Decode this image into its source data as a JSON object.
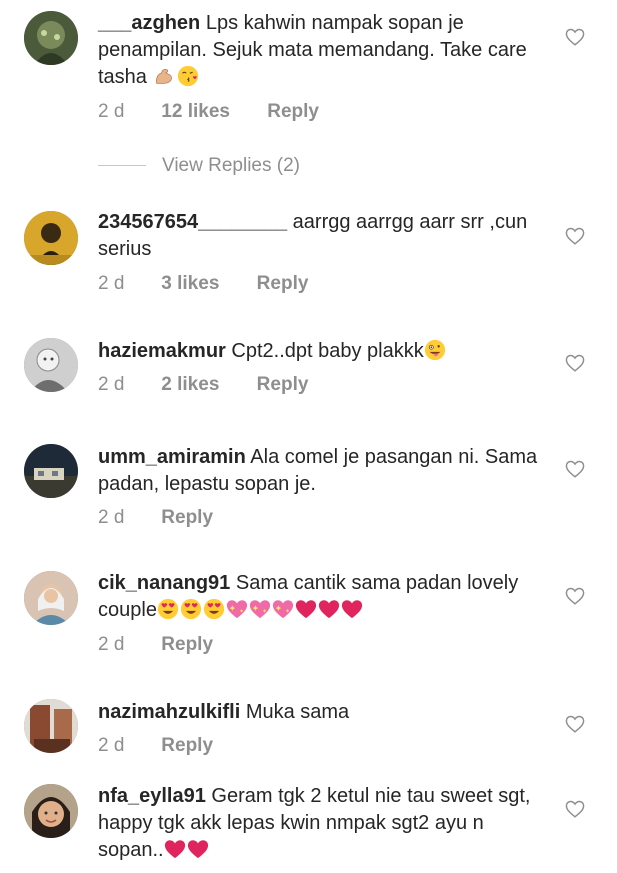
{
  "comments": [
    {
      "username": "___azghen",
      "text": "Lps kahwin nampak sopan je penampilan. Sejuk mata memandang. Take care tasha",
      "emojis": [
        "flexed-biceps-icon",
        "face-blowing-kiss-icon"
      ],
      "time": "2 d",
      "likes": "12 likes",
      "reply": "Reply",
      "avatar_color": "#5d6b4a"
    },
    {
      "username": "234567654________",
      "text": "aarrgg aarrgg aarr srr ,cun serius",
      "emojis": [],
      "time": "2 d",
      "likes": "3 likes",
      "reply": "Reply",
      "avatar_color": "#c9a227"
    },
    {
      "username": "haziemakmur",
      "text": "Cpt2..dpt baby plakkk",
      "emojis": [
        "zany-face-icon"
      ],
      "time": "2 d",
      "likes": "2 likes",
      "reply": "Reply",
      "avatar_color": "#9a9a9a"
    },
    {
      "username": "umm_amiramin",
      "text": "Ala comel je pasangan ni. Sama padan, lepastu sopan je.",
      "emojis": [],
      "time": "2 d",
      "likes": "",
      "reply": "Reply",
      "avatar_color": "#3b4a5a"
    },
    {
      "username": "cik_nanang91",
      "text": "Sama cantik sama padan lovely couple",
      "emojis": [
        "heart-eyes-icon",
        "heart-eyes-icon",
        "heart-eyes-icon",
        "sparkling-heart-icon",
        "sparkling-heart-icon",
        "sparkling-heart-icon",
        "red-heart-icon",
        "red-heart-icon",
        "red-heart-icon"
      ],
      "time": "2 d",
      "likes": "",
      "reply": "Reply",
      "avatar_color": "#b89a86"
    },
    {
      "username": "nazimahzulkifli",
      "text": "Muka sama",
      "emojis": [],
      "time": "2 d",
      "likes": "",
      "reply": "Reply",
      "avatar_color": "#7a4a3a"
    },
    {
      "username": "nfa_eylla91",
      "text": "Geram tgk 2 ketul nie tau sweet sgt, happy tgk akk lepas kwin nmpak sgt2 ayu n sopan..",
      "emojis": [
        "red-heart-icon",
        "red-heart-icon"
      ],
      "time": "",
      "likes": "",
      "reply": "",
      "avatar_color": "#c09070"
    }
  ],
  "view_replies": "View Replies (2)",
  "colors": {
    "text": "#262626",
    "meta": "#8e8e8e",
    "heart_red": "#e0245e"
  }
}
